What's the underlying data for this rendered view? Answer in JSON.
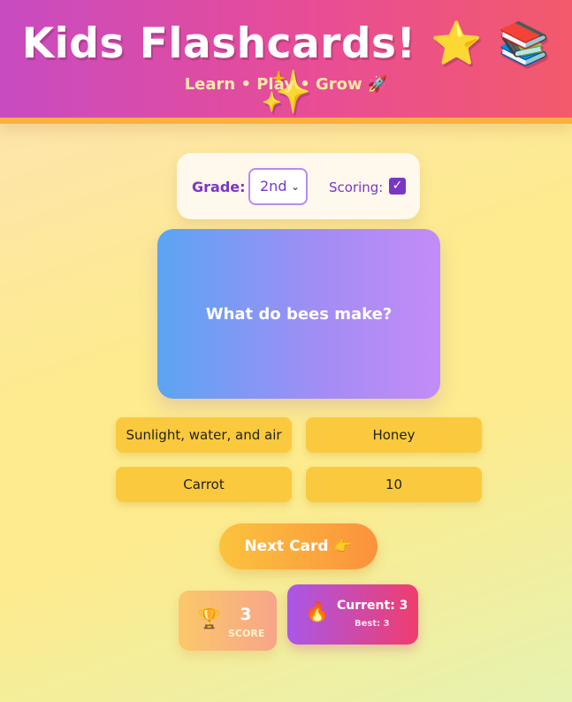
{
  "header": {
    "title": "Kids Flashcards! ⭐ 📚 ✨",
    "subtitle": "Learn • Play • Grow 🚀"
  },
  "controls": {
    "grade_label": "Grade:",
    "grade_value": "2nd",
    "scoring_label": "Scoring:",
    "scoring_checked": true
  },
  "card": {
    "question": "What do bees make?"
  },
  "answers": [
    "Sunlight, water, and air",
    "Honey",
    "Carrot",
    "10"
  ],
  "next_button": "Next Card 👉",
  "score": {
    "value": "3",
    "label": "SCORE",
    "icon": "trophy-icon"
  },
  "streak": {
    "current": "Current: 3",
    "best": "Best: 3",
    "icon": "flame-icon"
  },
  "colors": {
    "header_start": "#c84bc1",
    "header_end": "#f35a6b",
    "accent_purple": "#7a37c4",
    "answer_yellow": "#fbc93d"
  }
}
